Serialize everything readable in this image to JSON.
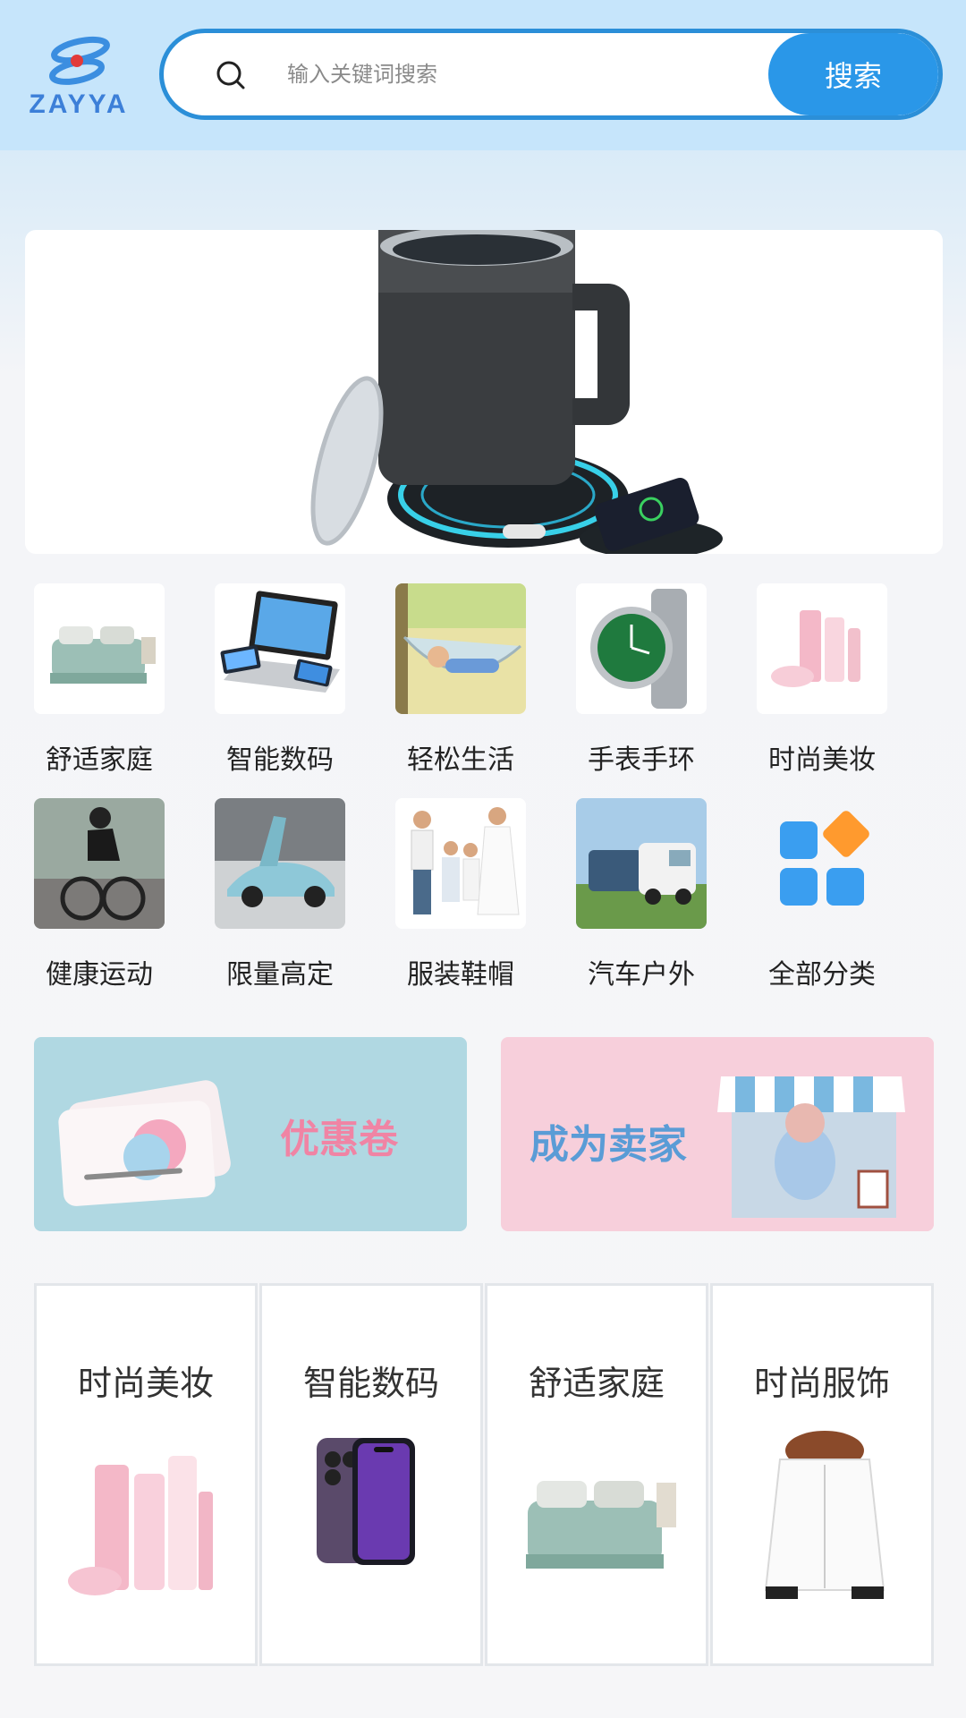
{
  "header": {
    "logo_text": "ZAYYA",
    "search_placeholder": "输入关键词搜索",
    "search_button": "搜索"
  },
  "categories": [
    {
      "label": "舒适家庭",
      "icon": "bed-image"
    },
    {
      "label": "智能数码",
      "icon": "laptop-phones-image"
    },
    {
      "label": "轻松生活",
      "icon": "hammock-image"
    },
    {
      "label": "手表手环",
      "icon": "watch-image"
    },
    {
      "label": "时尚美妆",
      "icon": "cosmetics-image"
    },
    {
      "label": "健康运动",
      "icon": "cyclist-image"
    },
    {
      "label": "限量高定",
      "icon": "sports-car-image"
    },
    {
      "label": "服装鞋帽",
      "icon": "family-image"
    },
    {
      "label": "汽车户外",
      "icon": "camper-van-image"
    },
    {
      "label": "全部分类",
      "icon": "all-categories-icon"
    }
  ],
  "promos": {
    "coupon": "优惠卷",
    "seller": "成为卖家"
  },
  "featured": [
    {
      "title": "时尚美妆",
      "icon": "cosmetics-image"
    },
    {
      "title": "智能数码",
      "icon": "smartphone-image"
    },
    {
      "title": "舒适家庭",
      "icon": "bed-image"
    },
    {
      "title": "时尚服饰",
      "icon": "jacket-image"
    }
  ],
  "colors": {
    "accent": "#2a97e8",
    "header_bg": "#c6e5fb",
    "coupon_bg": "#b0d8e2",
    "seller_bg": "#f7cfdb"
  }
}
